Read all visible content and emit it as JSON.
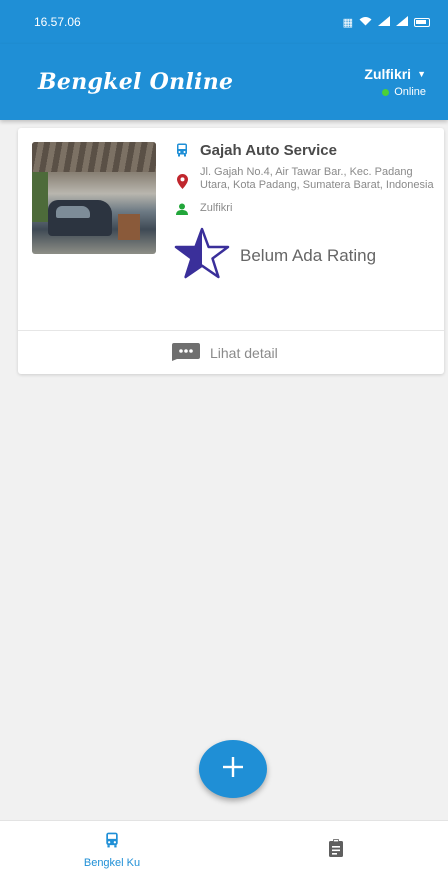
{
  "status_bar": {
    "time": "16.57.06",
    "icons": [
      "sim-icon",
      "wifi-icon",
      "signal-icon",
      "signal-icon",
      "battery-icon"
    ]
  },
  "app_bar": {
    "title": "Bengkel Online",
    "user_name": "Zulfikri",
    "user_status": "Online"
  },
  "card": {
    "shop_name": "Gajah Auto Service",
    "address": "Jl. Gajah No.4, Air Tawar Bar., Kec. Padang Utara, Kota Padang, Sumatera Barat, Indonesia",
    "owner": "Zulfikri",
    "rating_text": "Belum Ada Rating",
    "detail_label": "Lihat detail"
  },
  "bottom_nav": {
    "items": [
      {
        "label": "Bengkel Ku",
        "icon": "bus-icon",
        "active": true
      },
      {
        "label": "",
        "icon": "clipboard-icon",
        "active": false
      }
    ]
  },
  "colors": {
    "primary": "#1f8fd6",
    "star": "#3a2f9a",
    "location": "#c0262d",
    "person": "#22a63a",
    "online": "#4cd137"
  }
}
